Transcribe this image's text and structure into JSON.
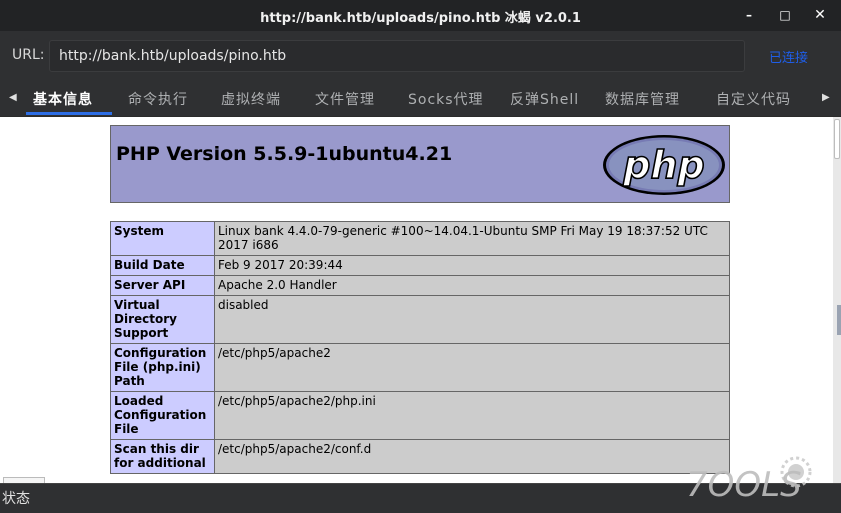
{
  "window": {
    "title": "http://bank.htb/uploads/pino.htb 冰蝎 v2.0.1",
    "min": "–",
    "max": "□",
    "close": "✕"
  },
  "urlbar": {
    "label": "URL:",
    "value": "http://bank.htb/uploads/pino.htb",
    "status": "已连接"
  },
  "tabs": [
    {
      "label": "基本信息"
    },
    {
      "label": "命令执行"
    },
    {
      "label": "虚拟终端"
    },
    {
      "label": "文件管理"
    },
    {
      "label": "Socks代理"
    },
    {
      "label": "反弹Shell"
    },
    {
      "label": "数据库管理"
    },
    {
      "label": "自定义代码"
    }
  ],
  "phpinfo": {
    "title": "PHP Version 5.5.9-1ubuntu4.21",
    "logo_text": "php",
    "rows": [
      {
        "key": "System",
        "value": "Linux bank 4.4.0-79-generic #100~14.04.1-Ubuntu SMP Fri May 19 18:37:52 UTC 2017 i686"
      },
      {
        "key": "Build Date",
        "value": "Feb 9 2017 20:39:44"
      },
      {
        "key": "Server API",
        "value": "Apache 2.0 Handler"
      },
      {
        "key": "Virtual Directory Support",
        "value": "disabled"
      },
      {
        "key": "Configuration File (php.ini) Path",
        "value": "/etc/php5/apache2"
      },
      {
        "key": "Loaded Configuration File",
        "value": "/etc/php5/apache2/php.ini"
      },
      {
        "key": "Scan this dir for additional",
        "value": "/etc/php5/apache2/conf.d"
      }
    ]
  },
  "statusbar": {
    "text": "状态"
  },
  "watermark": "7OOLS"
}
